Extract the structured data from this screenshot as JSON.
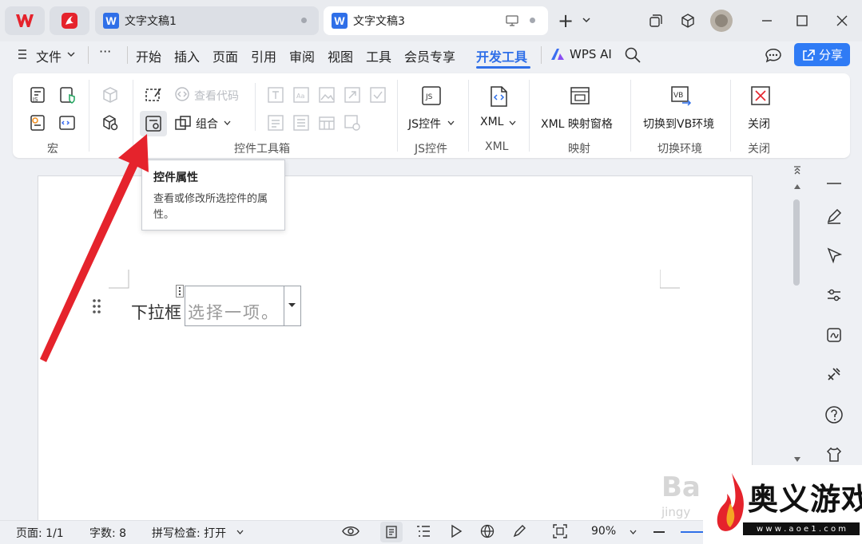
{
  "tabs": {
    "tab1_title": "文字文稿1",
    "tab3_title": "文字文稿3",
    "new_tab": "+"
  },
  "menu": {
    "file": "文件",
    "more": "···",
    "items": [
      "开始",
      "插入",
      "页面",
      "引用",
      "审阅",
      "视图",
      "工具",
      "会员专享",
      "开发工具"
    ],
    "active": "开发工具",
    "wps_ai": "WPS AI",
    "share": "分享"
  },
  "ribbon": {
    "view_code": "查看代码",
    "group_combo": "组合",
    "js_control": "JS控件",
    "xml": "XML",
    "xml_pane": "XML 映射窗格",
    "switch_vb": "切换到VB环境",
    "close": "关闭",
    "labels": {
      "macro": "宏",
      "toolbox": "控件工具箱",
      "js": "JS控件",
      "xml": "XML",
      "mapping": "映射",
      "switch_env": "切换环境",
      "close": "关闭"
    },
    "js_icon_text": "JS",
    "vb_icon_text": "VB"
  },
  "tooltip": {
    "title": "控件属性",
    "description": "查看或修改所选控件的属性。"
  },
  "document": {
    "label": "下拉框",
    "dropdown_placeholder": "选择一项。"
  },
  "status": {
    "page": "页面: 1/1",
    "words": "字数: 8",
    "spell": "拼写检查: 打开",
    "zoom": "90%"
  },
  "watermark": {
    "brand": "奥义游戏网",
    "url": "w w w . a o e 1 . c o m",
    "baidu": "Ba",
    "jingyan": "jingy"
  },
  "colors": {
    "accent": "#2f6fe8",
    "arrow": "#e5232c"
  }
}
